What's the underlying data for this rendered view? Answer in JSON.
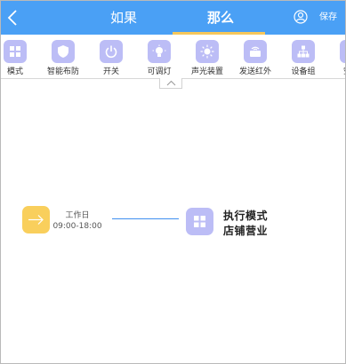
{
  "header": {
    "tabs": [
      {
        "label": "如果",
        "active": false
      },
      {
        "label": "那么",
        "active": true
      }
    ],
    "save_label": "保存",
    "accent_color": "#4aa0f5",
    "tab_underline_color": "#f6c75b"
  },
  "devices": [
    {
      "label": "模式",
      "icon": "grid-icon"
    },
    {
      "label": "智能布防",
      "icon": "shield-icon"
    },
    {
      "label": "开关",
      "icon": "power-icon"
    },
    {
      "label": "可调灯",
      "icon": "bulb-icon"
    },
    {
      "label": "声光装置",
      "icon": "alarm-icon"
    },
    {
      "label": "发送红外",
      "icon": "infrared-icon"
    },
    {
      "label": "设备组",
      "icon": "device-group-icon"
    },
    {
      "label": "空气",
      "icon": "air-icon"
    }
  ],
  "rule": {
    "trigger": {
      "title": "工作日",
      "time": "09:00-18:00",
      "icon": "arrow-right-icon",
      "color": "#f9cf5c"
    },
    "action": {
      "line1": "执行模式",
      "line2": "店铺营业",
      "icon": "grid-icon",
      "color": "#bcbdf6"
    },
    "connector_color": "#3f8ff0"
  }
}
